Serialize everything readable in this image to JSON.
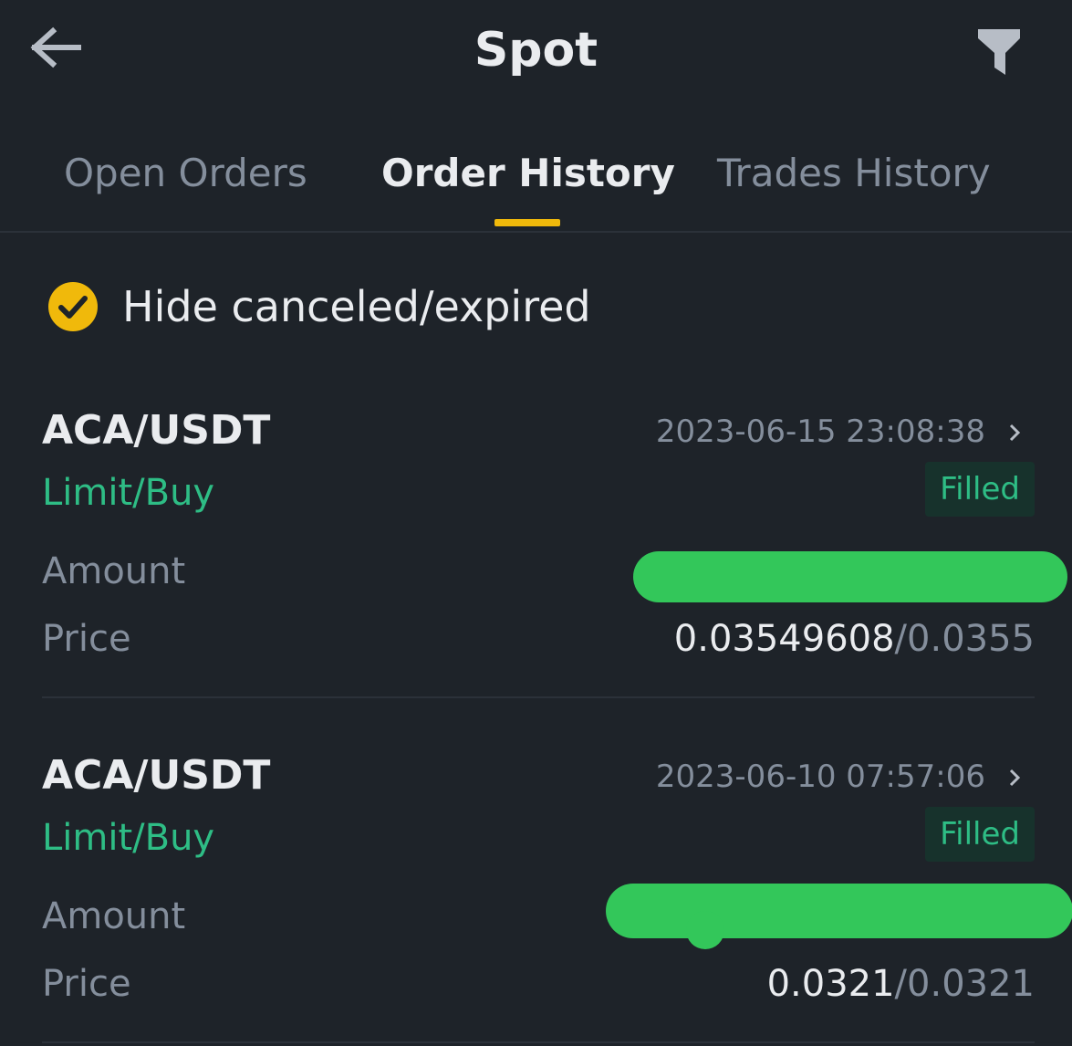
{
  "header": {
    "title": "Spot",
    "back_icon": "arrow-left-icon",
    "filter_icon": "filter-icon"
  },
  "tabs": [
    {
      "label": "Open Orders",
      "active": false
    },
    {
      "label": "Order History",
      "active": true
    },
    {
      "label": "Trades History",
      "active": false
    }
  ],
  "filter": {
    "hide_label": "Hide canceled/expired",
    "checked": true
  },
  "orders": [
    {
      "pair": "ACA/USDT",
      "datetime": "2023-06-15 23:08:38",
      "side": "Limit/Buy",
      "status": "Filled",
      "amount_label": "Amount",
      "price_label": "Price",
      "price_avg": "0.03549608",
      "price_sep": "/",
      "price_limit": "0.0355"
    },
    {
      "pair": "ACA/USDT",
      "datetime": "2023-06-10 07:57:06",
      "side": "Limit/Buy",
      "status": "Filled",
      "amount_label": "Amount",
      "price_label": "Price",
      "price_avg": "0.0321",
      "price_sep": "/",
      "price_limit": "0.0321"
    }
  ],
  "colors": {
    "background": "#1e2329",
    "accent": "#f0b90b",
    "buy": "#2ebd85",
    "muted": "#848e9c",
    "text": "#eaecef",
    "redaction": "#33c75a"
  }
}
